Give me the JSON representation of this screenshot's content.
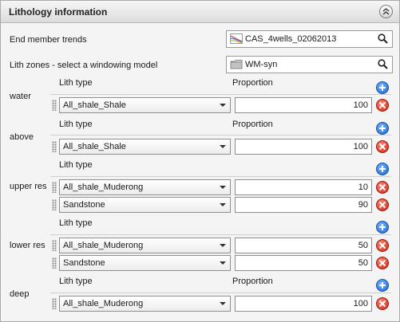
{
  "panel": {
    "title": "Lithology information"
  },
  "end_member": {
    "label": "End member trends",
    "value": "CAS_4wells_02062013",
    "icon": "crossplot-icon"
  },
  "lith_zones": {
    "label": "Lith zones - select a windowing model",
    "value": "WM-syn",
    "icon": "folder-icon"
  },
  "columns": {
    "lith_type": "Lith type",
    "proportion": "Proportion"
  },
  "zones": [
    {
      "name": "water",
      "rows": [
        {
          "lith": "All_shale_Shale",
          "proportion": "100"
        }
      ]
    },
    {
      "name": "above",
      "rows": [
        {
          "lith": "All_shale_Shale",
          "proportion": "100"
        }
      ]
    },
    {
      "name": "upper res",
      "rows": [
        {
          "lith": "All_shale_Muderong",
          "proportion": "10"
        },
        {
          "lith": "Sandstone",
          "proportion": "90"
        }
      ]
    },
    {
      "name": "lower res",
      "rows": [
        {
          "lith": "All_shale_Muderong",
          "proportion": "50"
        },
        {
          "lith": "Sandstone",
          "proportion": "50"
        }
      ]
    },
    {
      "name": "deep",
      "rows": [
        {
          "lith": "All_shale_Muderong",
          "proportion": "100"
        }
      ]
    }
  ],
  "colors": {
    "add": "#1c62cf",
    "delete": "#c9220f"
  }
}
